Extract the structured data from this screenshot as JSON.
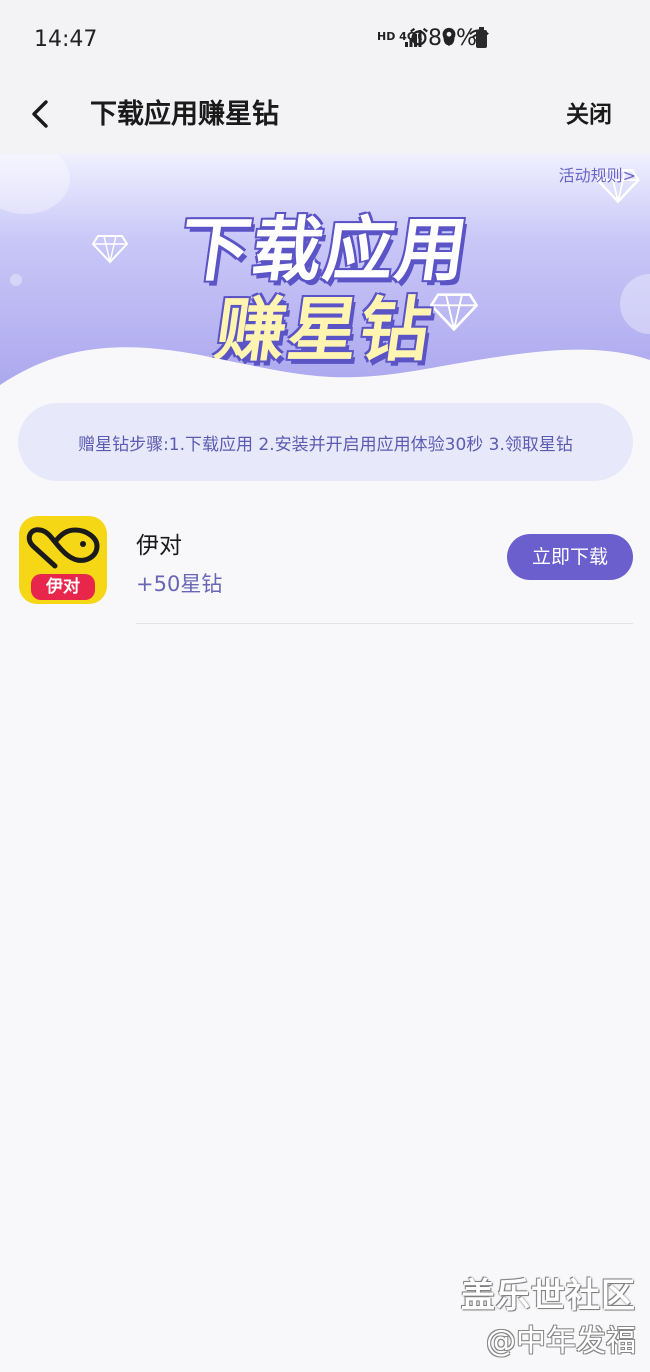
{
  "status_bar": {
    "time": "14:47",
    "network_label": "HD 4G",
    "battery": "80%"
  },
  "header": {
    "title": "下载应用赚星钻",
    "close_label": "关闭"
  },
  "banner": {
    "headline_line1": "下载应用",
    "headline_line2": "赚星钻",
    "rules_link": "活动规则>"
  },
  "steps": {
    "text": "赠星钻步骤:1.下载应用 2.安装并开启用应用体验30秒 3.领取星钻"
  },
  "apps": [
    {
      "name": "伊对",
      "icon_label": "伊对",
      "reward": "+50星钻",
      "button_label": "立即下载"
    }
  ],
  "watermark": {
    "line1": "盖乐世社区",
    "line2": "@中年发福"
  },
  "colors": {
    "accent": "#6b5fce",
    "banner_top": "#f0f0ff",
    "banner_bottom": "#a9a5ee",
    "icon_bg": "#f6d716",
    "icon_badge": "#e8264b"
  }
}
